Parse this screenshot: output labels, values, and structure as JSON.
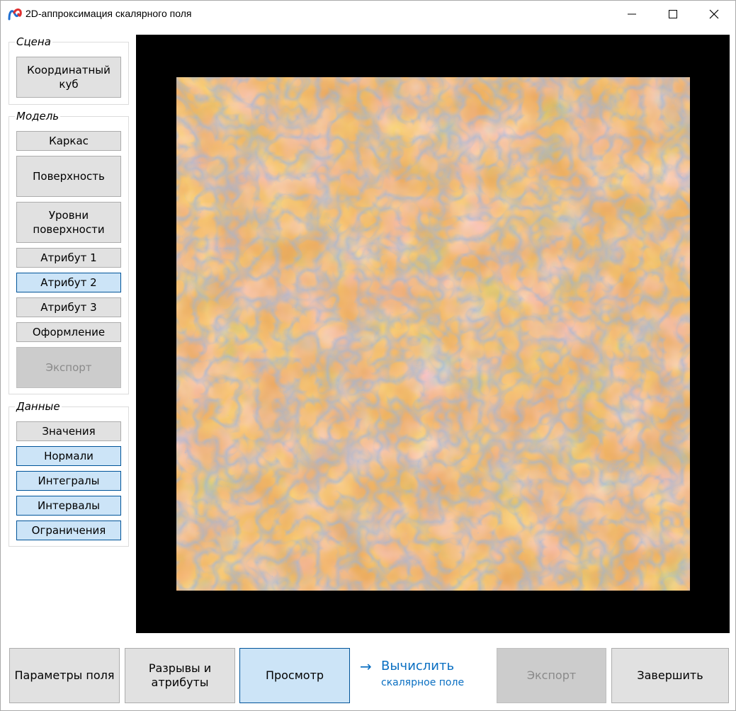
{
  "window": {
    "title": "2D-аппроксимация скалярного поля",
    "icons": {
      "app": "app-logo-icon",
      "minimize": "minimize-icon",
      "maximize": "maximize-icon",
      "close": "close-icon"
    }
  },
  "sidebar": {
    "scene": {
      "title": "Сцена",
      "coordinate_cube": "Координатный куб"
    },
    "model": {
      "title": "Модель",
      "wireframe": "Каркас",
      "surface": "Поверхность",
      "surface_levels": "Уровни поверхности",
      "attribute1": "Атрибут 1",
      "attribute2": "Атрибут 2",
      "attribute3": "Атрибут 3",
      "design": "Оформление",
      "export": "Экспорт"
    },
    "data": {
      "title": "Данные",
      "values": "Значения",
      "normals": "Нормали",
      "integrals": "Интегралы",
      "intervals": "Интервалы",
      "constraints": "Ограничения"
    }
  },
  "viewport": {
    "description_colors": {
      "background": "#000000",
      "warm": "#f6a43a",
      "cool": "#4b78c2",
      "neutral": "#a59a95"
    }
  },
  "bottom": {
    "field_params": "Параметры поля",
    "breaks_attrs": "Разрывы и атрибуты",
    "preview": "Просмотр",
    "compute_arrow": "→",
    "compute": "Вычислить",
    "compute_sub": "скалярное поле",
    "export": "Экспорт",
    "finish": "Завершить"
  }
}
